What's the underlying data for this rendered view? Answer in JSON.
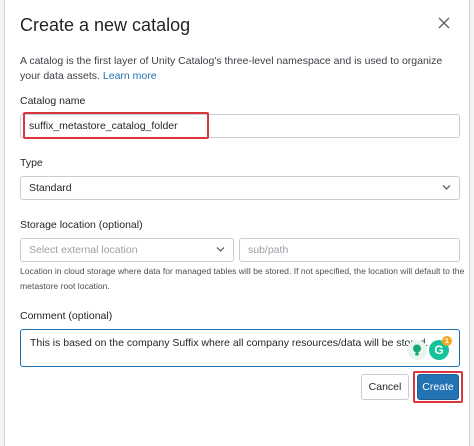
{
  "dialog": {
    "title": "Create a new catalog",
    "description": "A catalog is the first layer of Unity Catalog's three-level namespace and is used to organize your data assets.",
    "learn_more": "Learn more"
  },
  "catalog_name": {
    "label": "Catalog name",
    "value": "suffix_metastore_catalog_folder"
  },
  "type": {
    "label": "Type",
    "value": "Standard"
  },
  "storage": {
    "label": "Storage location (optional)",
    "external_placeholder": "Select external location",
    "subpath_placeholder": "sub/path",
    "hint": "Location in cloud storage where data for managed tables will be stored. If not specified, the location will default to the metastore root location."
  },
  "comment": {
    "label": "Comment (optional)",
    "value": "This is based on the company Suffix where all company resources/data will be stored."
  },
  "extensions": {
    "grammarly_badge": "1"
  },
  "buttons": {
    "cancel": "Cancel",
    "create": "Create"
  },
  "colors": {
    "accent": "#2272b4",
    "highlight": "#d9363e"
  }
}
